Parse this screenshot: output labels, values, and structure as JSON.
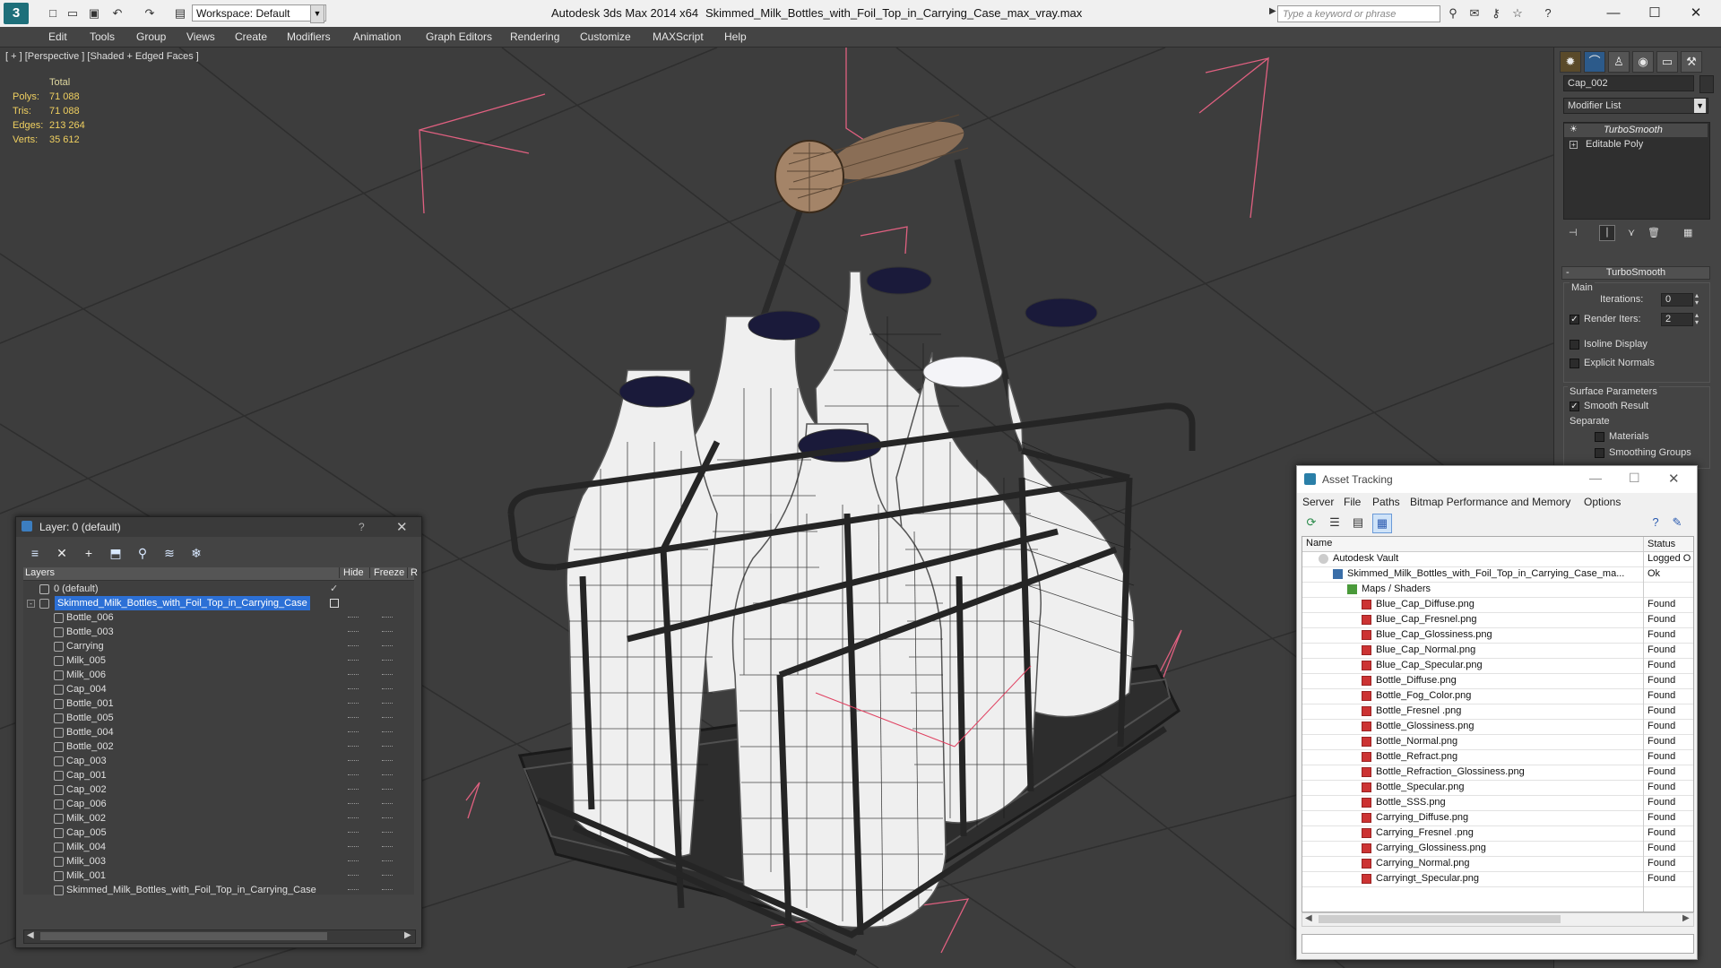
{
  "titlebar": {
    "workspace_label": "Workspace: Default",
    "app_title": "Autodesk 3ds Max  2014 x64",
    "file_title": "Skimmed_Milk_Bottles_with_Foil_Top_in_Carrying_Case_max_vray.max",
    "search_placeholder": "Type a keyword or phrase"
  },
  "menubar": {
    "items": [
      "Edit",
      "Tools",
      "Group",
      "Views",
      "Create",
      "Modifiers",
      "Animation",
      "Graph Editors",
      "Rendering",
      "Customize",
      "MAXScript",
      "Help"
    ]
  },
  "viewport": {
    "label": "[ + ] [Perspective ] [Shaded + Edged Faces ]",
    "stats": {
      "header": "Total",
      "polys_label": "Polys:",
      "polys": "71 088",
      "tris_label": "Tris:",
      "tris": "71 088",
      "edges_label": "Edges:",
      "edges": "213 264",
      "verts_label": "Verts:",
      "verts": "35 612"
    }
  },
  "command_panel": {
    "object_name": "Cap_002",
    "modifier_list_label": "Modifier List",
    "stack": [
      "TurboSmooth",
      "Editable Poly"
    ],
    "rollout_title": "TurboSmooth",
    "main_label": "Main",
    "iterations_label": "Iterations:",
    "iterations_value": "0",
    "render_iters_label": "Render Iters:",
    "render_iters_value": "2",
    "render_iters_checked": true,
    "isoline_label": "Isoline Display",
    "explicit_normals_label": "Explicit Normals",
    "surface_params_label": "Surface Parameters",
    "smooth_result_label": "Smooth Result",
    "smooth_result_checked": true,
    "separate_label": "Separate",
    "materials_label": "Materials",
    "smoothing_groups_label": "Smoothing Groups"
  },
  "layer_panel": {
    "title": "Layer: 0 (default)",
    "help": "?",
    "col_layers": "Layers",
    "col_hide": "Hide",
    "col_freeze": "Freeze",
    "col_r": "R",
    "rows": [
      "0 (default)",
      "Skimmed_Milk_Bottles_with_Foil_Top_in_Carrying_Case",
      "Bottle_006",
      "Bottle_003",
      "Carrying",
      "Milk_005",
      "Milk_006",
      "Cap_004",
      "Bottle_001",
      "Bottle_005",
      "Bottle_004",
      "Bottle_002",
      "Cap_003",
      "Cap_001",
      "Cap_002",
      "Cap_006",
      "Milk_002",
      "Cap_005",
      "Milk_004",
      "Milk_003",
      "Milk_001",
      "Skimmed_Milk_Bottles_with_Foil_Top_in_Carrying_Case"
    ]
  },
  "asset_tracking": {
    "title": "Asset Tracking",
    "menu": [
      "Server",
      "File",
      "Paths",
      "Bitmap Performance and Memory",
      "Options"
    ],
    "col_name": "Name",
    "col_status": "Status",
    "vault": {
      "name": "Autodesk Vault",
      "status": "Logged O"
    },
    "file": {
      "name": "Skimmed_Milk_Bottles_with_Foil_Top_in_Carrying_Case_ma...",
      "status": "Ok"
    },
    "group": {
      "name": "Maps / Shaders",
      "status": ""
    },
    "maps": [
      {
        "name": "Blue_Cap_Diffuse.png",
        "status": "Found"
      },
      {
        "name": "Blue_Cap_Fresnel.png",
        "status": "Found"
      },
      {
        "name": "Blue_Cap_Glossiness.png",
        "status": "Found"
      },
      {
        "name": "Blue_Cap_Normal.png",
        "status": "Found"
      },
      {
        "name": "Blue_Cap_Specular.png",
        "status": "Found"
      },
      {
        "name": "Bottle_Diffuse.png",
        "status": "Found"
      },
      {
        "name": "Bottle_Fog_Color.png",
        "status": "Found"
      },
      {
        "name": "Bottle_Fresnel .png",
        "status": "Found"
      },
      {
        "name": "Bottle_Glossiness.png",
        "status": "Found"
      },
      {
        "name": "Bottle_Normal.png",
        "status": "Found"
      },
      {
        "name": "Bottle_Refract.png",
        "status": "Found"
      },
      {
        "name": "Bottle_Refraction_Glossiness.png",
        "status": "Found"
      },
      {
        "name": "Bottle_Specular.png",
        "status": "Found"
      },
      {
        "name": "Bottle_SSS.png",
        "status": "Found"
      },
      {
        "name": "Carrying_Diffuse.png",
        "status": "Found"
      },
      {
        "name": "Carrying_Fresnel .png",
        "status": "Found"
      },
      {
        "name": "Carrying_Glossiness.png",
        "status": "Found"
      },
      {
        "name": "Carrying_Normal.png",
        "status": "Found"
      },
      {
        "name": "Carryingt_Specular.png",
        "status": "Found"
      }
    ]
  }
}
